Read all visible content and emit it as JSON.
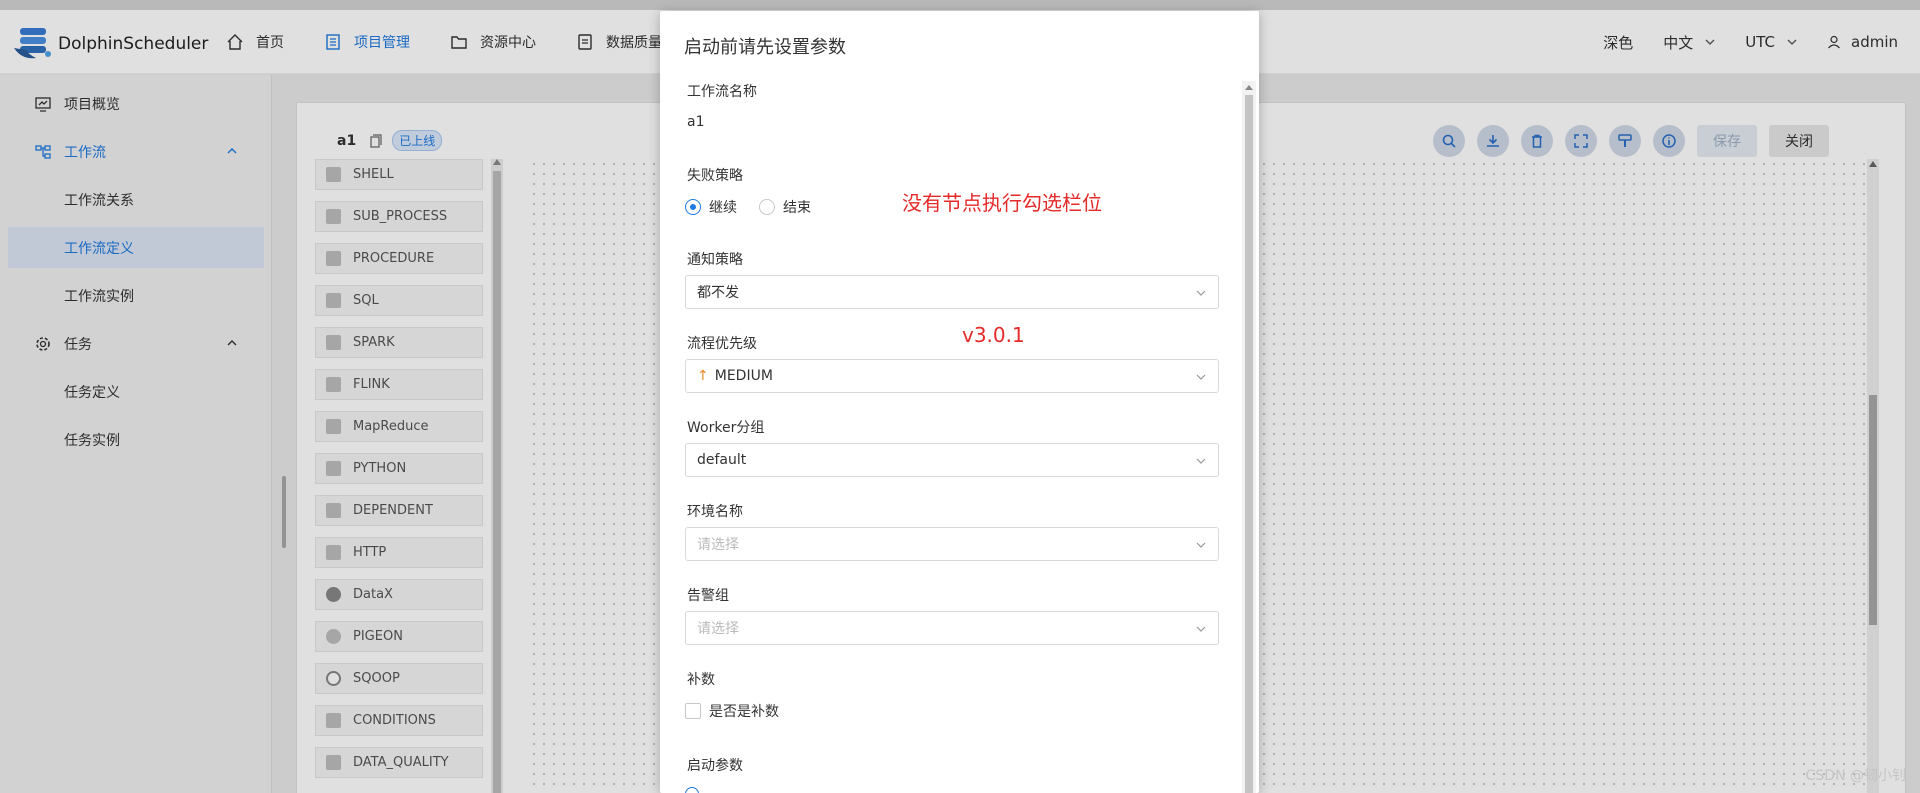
{
  "app": {
    "logo_text": "DolphinScheduler"
  },
  "nav": {
    "items": [
      {
        "label": "首页",
        "icon": "home-icon"
      },
      {
        "label": "项目管理",
        "icon": "project-icon"
      },
      {
        "label": "资源中心",
        "icon": "folder-icon"
      },
      {
        "label": "数据质量",
        "icon": "data-quality-icon"
      }
    ],
    "theme": "深色",
    "language": "中文",
    "timezone": "UTC",
    "user": "admin"
  },
  "sidebar": {
    "items": [
      {
        "label": "项目概览",
        "icon": "dashboard-icon"
      },
      {
        "label": "工作流",
        "icon": "workflow-icon"
      },
      {
        "label": "工作流关系"
      },
      {
        "label": "工作流定义"
      },
      {
        "label": "工作流实例"
      },
      {
        "label": "任务",
        "icon": "gear-icon"
      },
      {
        "label": "任务定义"
      },
      {
        "label": "任务实例"
      }
    ]
  },
  "workflow": {
    "name": "a1",
    "status": "已上线",
    "save_label": "保存",
    "close_label": "关闭"
  },
  "tasks": [
    "SHELL",
    "SUB_PROCESS",
    "PROCEDURE",
    "SQL",
    "SPARK",
    "FLINK",
    "MapReduce",
    "PYTHON",
    "DEPENDENT",
    "HTTP",
    "DataX",
    "PIGEON",
    "SQOOP",
    "CONDITIONS",
    "DATA_QUALITY"
  ],
  "modal": {
    "title": "启动前请先设置参数",
    "workflow_name_label": "工作流名称",
    "workflow_name_value": "a1",
    "failure_strategy_label": "失败策略",
    "failure_strategy_options": [
      "继续",
      "结束"
    ],
    "notify_strategy_label": "通知策略",
    "notify_strategy_value": "都不发",
    "priority_label": "流程优先级",
    "priority_value": "MEDIUM",
    "worker_group_label": "Worker分组",
    "worker_group_value": "default",
    "env_label": "环境名称",
    "env_placeholder": "请选择",
    "alert_group_label": "告警组",
    "alert_group_placeholder": "请选择",
    "complement_label": "补数",
    "complement_checkbox": "是否是补数",
    "startup_params_label": "启动参数"
  },
  "annotations": {
    "note1": "没有节点执行勾选栏位",
    "note2": "v3.0.1"
  },
  "watermark": "CSDN @韧小钊",
  "colors": {
    "accent": "#1f7ae0",
    "annotation": "#e52a2a",
    "priority_arrow": "#f08a24"
  }
}
